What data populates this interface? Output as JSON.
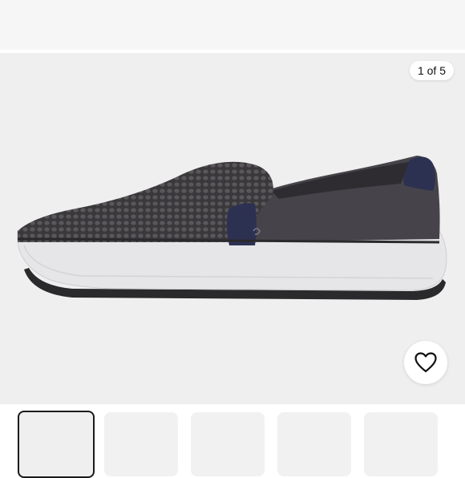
{
  "gallery": {
    "counter_text": "1 of 5",
    "current_index": 1,
    "total_images": 5,
    "background_color": "#efefef"
  },
  "product_image": {
    "icon": "slip-on-mesh-sneaker",
    "upper_color": "#3f3d40",
    "sole_color": "#e6e6e8",
    "heel_tab_color": "#2d3151"
  },
  "actions": {
    "like_icon": "heart-outline-icon"
  },
  "thumbnails": {
    "count": 5,
    "selected_index": 0
  }
}
